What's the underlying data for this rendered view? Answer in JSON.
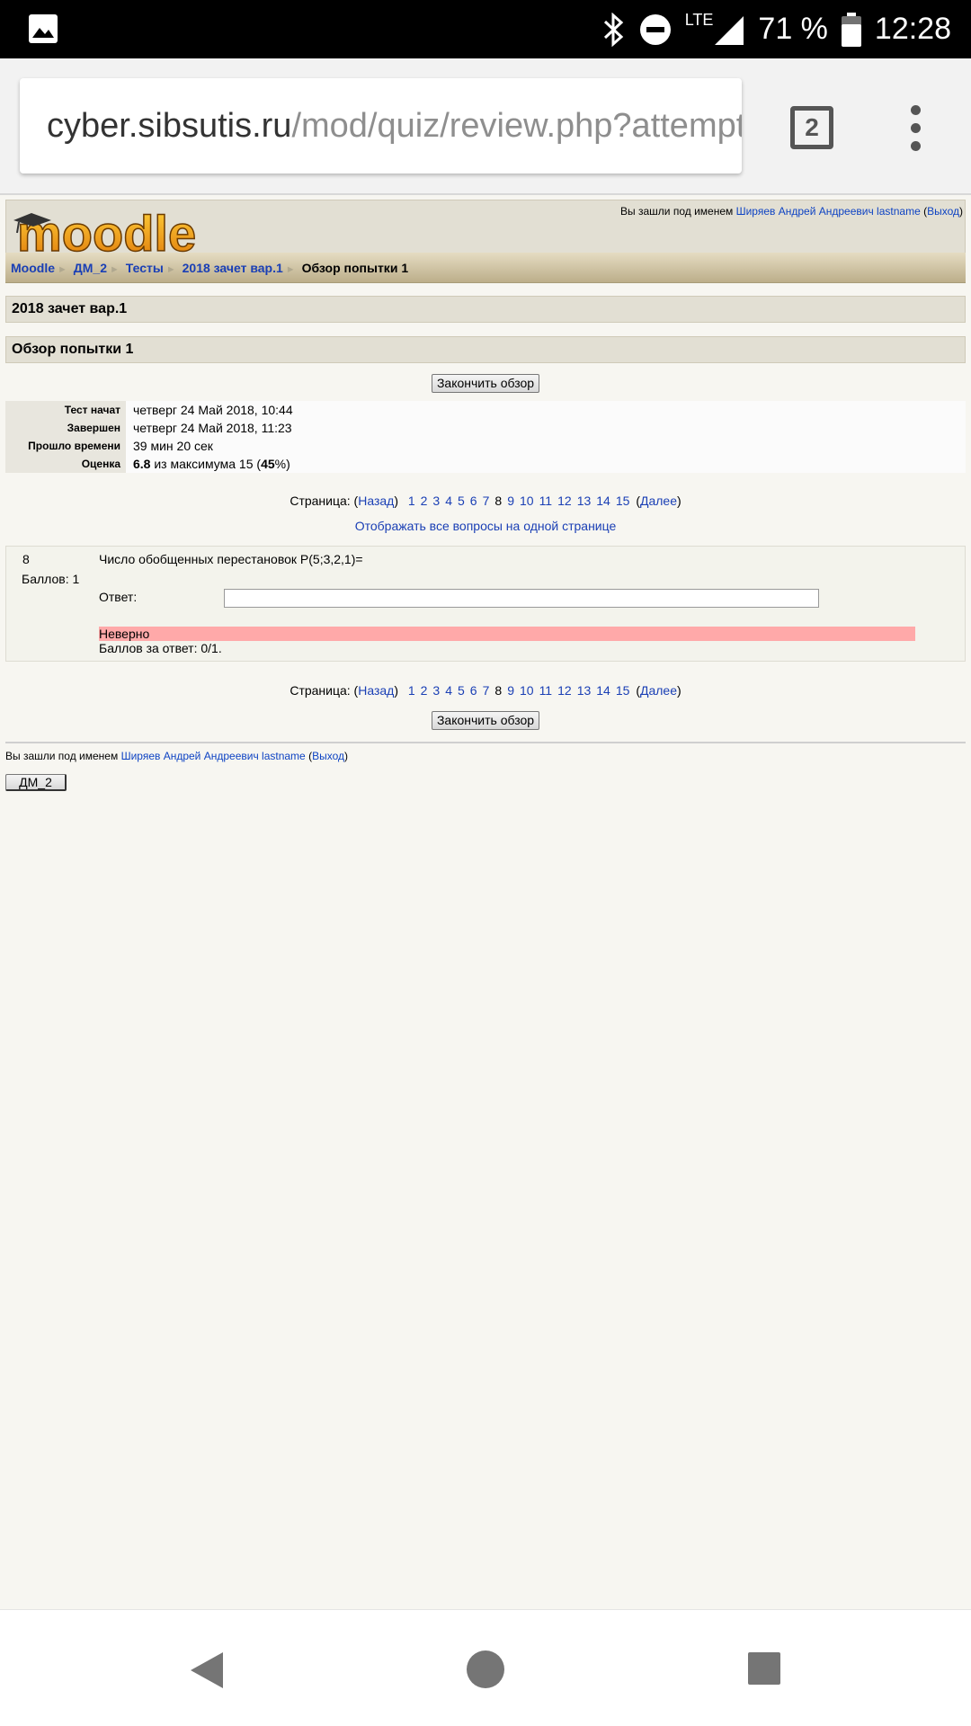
{
  "status_bar": {
    "battery": "71 %",
    "network": "LTE",
    "time": "12:28"
  },
  "browser": {
    "url_host": "cyber.sibsutis.ru",
    "url_path": "/mod/quiz/review.php?attempt",
    "tab_count": "2"
  },
  "header": {
    "logo_text": "moodle",
    "logged_in_prefix": "Вы зашли под именем",
    "user_name": "Ширяев Андрей Андреевич lastname",
    "logout": "Выход"
  },
  "breadcrumb": [
    {
      "label": "Moodle"
    },
    {
      "label": "ДМ_2"
    },
    {
      "label": "Тесты"
    },
    {
      "label": "2018 зачет вар.1"
    },
    {
      "label": "Обзор попытки 1"
    }
  ],
  "quiz_title": "2018 зачет вар.1",
  "attempt_title": "Обзор попытки 1",
  "finish_review_label": "Закончить обзор",
  "summary": {
    "rows": [
      {
        "label": "Тест начат",
        "value": "четверг 24 Май 2018, 10:44"
      },
      {
        "label": "Завершен",
        "value": "четверг 24 Май 2018, 11:23"
      },
      {
        "label": "Прошло времени",
        "value": "39 мин 20 сек"
      }
    ],
    "grade_label": "Оценка",
    "grade_score": "6.8",
    "grade_mid": "из максимума 15 (",
    "grade_percent": "45",
    "grade_end": "%)"
  },
  "paging": {
    "prefix": "Страница: (",
    "prev": "Назад",
    "close_paren": ")",
    "pages_before": [
      "1",
      "2",
      "3",
      "4",
      "5",
      "6",
      "7"
    ],
    "current": "8",
    "pages_after": [
      "9",
      "10",
      "11",
      "12",
      "13",
      "14",
      "15"
    ],
    "open_paren": "(",
    "next": "Далее",
    "end": ")"
  },
  "show_all_label": "Отображать все вопросы на одной странице",
  "question": {
    "number": "8",
    "grade": "Баллов: 1",
    "text": "Число обобщенных перестановок P(5;3,2,1)=",
    "answer_label": "Ответ:",
    "answer_value": "",
    "result": "Неверно",
    "score": "Баллов за ответ: 0/1."
  },
  "footer": {
    "logged_in_prefix": "Вы зашли под именем",
    "user_name": "Ширяев Андрей Андреевич lastname",
    "logout": "Выход",
    "course_button": "ДМ_2"
  }
}
